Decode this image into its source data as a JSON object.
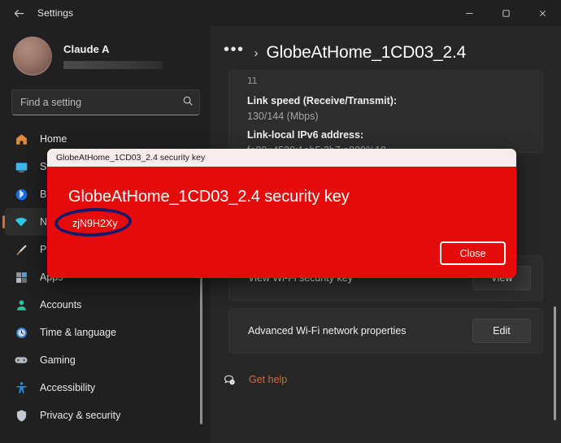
{
  "window": {
    "title": "Settings",
    "back_icon": "back-arrow-icon",
    "minimize_label": "Minimize",
    "maximize_label": "Maximize",
    "close_label": "Close"
  },
  "sidebar": {
    "profile": {
      "name": "Claude A",
      "email_redacted": ""
    },
    "search": {
      "placeholder": "Find a setting",
      "value": "",
      "icon": "search-icon"
    },
    "items": [
      {
        "label": "Home",
        "icon": "home-icon",
        "selected": false
      },
      {
        "label": "System",
        "icon": "system-icon",
        "selected": false
      },
      {
        "label": "Bluetooth",
        "icon": "bluetooth-icon",
        "selected": false
      },
      {
        "label": "Network",
        "icon": "wifi-icon",
        "selected": true
      },
      {
        "label": "Personalization",
        "icon": "paintbrush-icon",
        "selected": false
      },
      {
        "label": "Apps",
        "icon": "apps-icon",
        "selected": false
      },
      {
        "label": "Accounts",
        "icon": "account-icon",
        "selected": false
      },
      {
        "label": "Time & language",
        "icon": "clock-icon",
        "selected": false
      },
      {
        "label": "Gaming",
        "icon": "gamepad-icon",
        "selected": false
      },
      {
        "label": "Accessibility",
        "icon": "accessibility-icon",
        "selected": false
      },
      {
        "label": "Privacy & security",
        "icon": "shield-icon",
        "selected": false
      }
    ]
  },
  "main": {
    "breadcrumb": {
      "overflow": "•••",
      "separator": "›",
      "title": "GlobeAtHome_1CD03_2.4"
    },
    "details": {
      "clipped_top": "11",
      "link_speed_label": "Link speed (Receive/Transmit):",
      "link_speed_value": "130/144 (Mbps)",
      "ipv6_label": "Link-local IPv6 address:",
      "ipv6_value": "fe80::4539:1eb5:2b7:a809%18"
    },
    "rows": [
      {
        "label": "View Wi-Fi security key",
        "button": "View"
      },
      {
        "label": "Advanced Wi-Fi network properties",
        "button": "Edit"
      }
    ],
    "get_help": {
      "label": "Get help",
      "icon": "help-bubble-icon",
      "color": "#cf6a3f"
    }
  },
  "dialog": {
    "titlebar": "GlobeAtHome_1CD03_2.4 security key",
    "heading": "GlobeAtHome_1CD03_2.4 security key",
    "key": "zjN9H2Xy",
    "close_button": "Close",
    "background_color": "#e60b0b",
    "annotation_color": "#141a6e"
  }
}
